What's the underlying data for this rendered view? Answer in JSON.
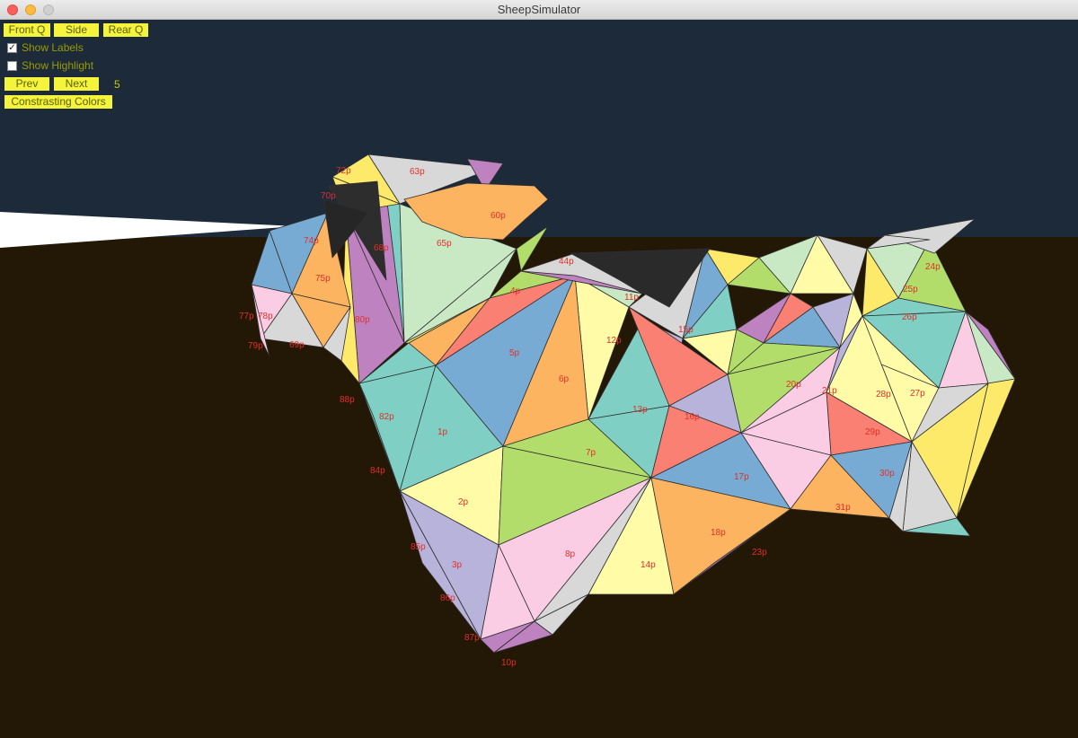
{
  "window": {
    "title": "SheepSimulator"
  },
  "controls": {
    "front_q": "Front Q",
    "side": "Side",
    "rear_q": "Rear Q",
    "show_labels": {
      "label": "Show Labels",
      "checked": true
    },
    "show_highlight": {
      "label": "Show Highlight",
      "checked": false
    },
    "prev": "Prev",
    "next": "Next",
    "page": "5",
    "contrasting_colors": "Constrasting Colors"
  },
  "scene": {
    "sky_color": "#1c2a3a",
    "ground_color": "#231706",
    "label_color": "#e0302a",
    "palette": [
      "#7fcfc4",
      "#fffba7",
      "#b8b3da",
      "#f98073",
      "#78abd3",
      "#fcb460",
      "#b2dd6a",
      "#fbcde4",
      "#d8d8d8",
      "#c9e9c5",
      "#fdea6b",
      "#bf82c0"
    ],
    "panel_labels": [
      "1p",
      "2p",
      "3p",
      "4p",
      "5p",
      "6p",
      "7p",
      "8p",
      "10p",
      "11p",
      "12p",
      "13p",
      "14p",
      "15p",
      "16p",
      "17p",
      "18p",
      "20p",
      "21p",
      "23p",
      "24p",
      "25p",
      "26p",
      "27p",
      "28p",
      "29p",
      "30p",
      "31p",
      "44p",
      "60p",
      "63p",
      "65p",
      "68p",
      "69p",
      "70p",
      "72p",
      "74p",
      "75p",
      "77p",
      "78p",
      "79p",
      "80p",
      "82p",
      "84p",
      "85p",
      "86p",
      "87p",
      "88p"
    ]
  }
}
